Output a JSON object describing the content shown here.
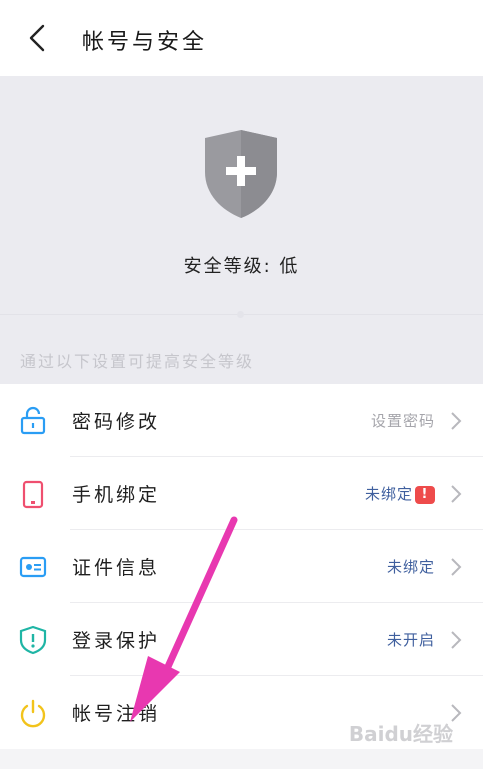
{
  "header": {
    "title": "帐号与安全",
    "back_icon": "chevron-left-icon"
  },
  "security": {
    "shield_icon": "shield-plus-icon",
    "level_text": "安全等级: 低",
    "tip": "通过以下设置可提高安全等级"
  },
  "items": [
    {
      "label": "密码修改",
      "value": "设置密码",
      "icon": "lock-icon",
      "icon_color": "#2a9df4",
      "value_color": "#a5a5ab"
    },
    {
      "label": "手机绑定",
      "value": "未绑定",
      "icon": "phone-icon",
      "icon_color": "#ef4f6f",
      "value_color": "#3f5f9e",
      "badge": "!"
    },
    {
      "label": "证件信息",
      "value": "未绑定",
      "icon": "id-card-icon",
      "icon_color": "#2a9df4",
      "value_color": "#3f5f9e"
    },
    {
      "label": "登录保护",
      "value": "未开启",
      "icon": "shield-alert-icon",
      "icon_color": "#1fb5a5",
      "value_color": "#3f5f9e"
    },
    {
      "label": "帐号注销",
      "value": "",
      "icon": "power-icon",
      "icon_color": "#f2c31b"
    }
  ],
  "annotation": {
    "arrow_color": "#e838b0"
  },
  "watermark": "Baidu经验"
}
